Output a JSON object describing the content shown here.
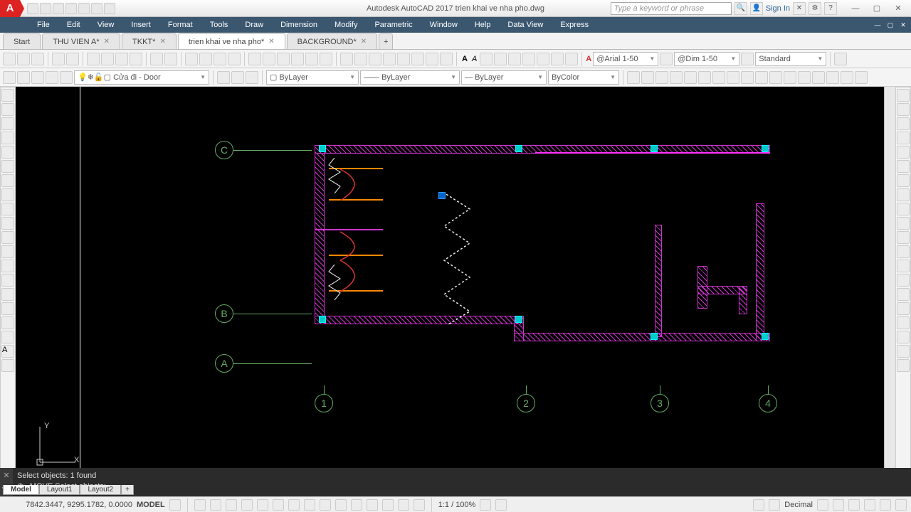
{
  "titlebar": {
    "app_title": "Autodesk AutoCAD 2017   trien khai ve nha pho.dwg",
    "search_placeholder": "Type a keyword or phrase",
    "signin": "Sign In"
  },
  "menu": [
    "File",
    "Edit",
    "View",
    "Insert",
    "Format",
    "Tools",
    "Draw",
    "Dimension",
    "Modify",
    "Parametric",
    "Window",
    "Help",
    "Data View",
    "Express"
  ],
  "tabs": [
    {
      "label": "Start",
      "active": false,
      "closable": false
    },
    {
      "label": "THU VIEN A*",
      "active": false,
      "closable": true
    },
    {
      "label": "TKKT*",
      "active": false,
      "closable": true
    },
    {
      "label": "trien khai ve nha pho*",
      "active": true,
      "closable": true
    },
    {
      "label": "BACKGROUND*",
      "active": false,
      "closable": true
    }
  ],
  "toolbar1": {
    "text_style": "@Arial 1-50",
    "dim_style": "@Dim 1-50",
    "table_style": "Standard"
  },
  "toolbar2": {
    "layer": "Cửa đi - Door",
    "linetype_sel": "ByLayer",
    "linetype2": "ByLayer",
    "lineweight": "ByLayer",
    "color": "ByColor"
  },
  "grid_labels_row": [
    "A",
    "B",
    "C"
  ],
  "grid_labels_col": [
    "1",
    "2",
    "3",
    "4"
  ],
  "ucs": {
    "x": "X",
    "y": "Y"
  },
  "command": {
    "line1": "Select objects: 1 found",
    "line2": "MOVE Select objects:",
    "prefix": "⊕"
  },
  "layout_tabs": [
    "Model",
    "Layout1",
    "Layout2"
  ],
  "status": {
    "coords": "7842.3447, 9295.1782, 0.0000",
    "mode": "MODEL",
    "scale": "1:1 / 100%",
    "units": "Decimal"
  }
}
